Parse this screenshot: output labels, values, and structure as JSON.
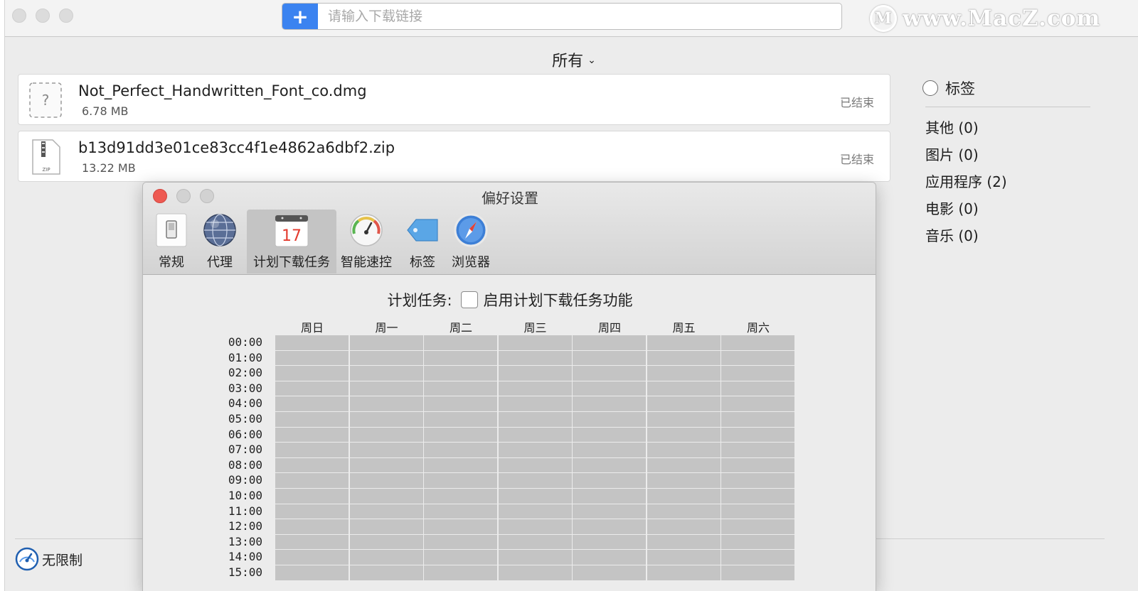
{
  "toolbar": {
    "add_icon": "plus-icon",
    "url_placeholder": "请输入下载链接",
    "accent": "#3b83f0"
  },
  "watermark": {
    "text": "www.MacZ.com",
    "logo_glyph": "M"
  },
  "filter": {
    "label": "所有"
  },
  "downloads": [
    {
      "name": "Not_Perfect_Handwritten_Font_co.dmg",
      "size": "6.78 MB",
      "status": "已结束",
      "icon": "unknown-file-icon",
      "glyph": "?"
    },
    {
      "name": "b13d91dd3e01ce83cc4f1e4862a6dbf2.zip",
      "size": "13.22 MB",
      "status": "已结束",
      "icon": "zip-file-icon",
      "glyph": "ZIP"
    }
  ],
  "sidebar": {
    "header": "标签",
    "items": [
      "其他 (0)",
      "图片 (0)",
      "应用程序 (2)",
      "电影 (0)",
      "音乐 (0)"
    ]
  },
  "footer": {
    "speed_label": "无限制"
  },
  "prefs": {
    "title": "偏好设置",
    "tabs": [
      {
        "label": "常规",
        "icon": "switch-icon"
      },
      {
        "label": "代理",
        "icon": "globe-icon"
      },
      {
        "label": "计划下载任务",
        "icon": "calendar-icon",
        "active": true,
        "calendar_day": "17"
      },
      {
        "label": "智能速控",
        "icon": "speedometer-icon"
      },
      {
        "label": "标签",
        "icon": "tag-icon"
      },
      {
        "label": "浏览器",
        "icon": "compass-icon"
      }
    ],
    "schedule": {
      "label": "计划任务:",
      "checkbox_label": "启用计划下载任务功能",
      "enabled": false,
      "days": [
        "周日",
        "周一",
        "周二",
        "周三",
        "周四",
        "周五",
        "周六"
      ],
      "hours": [
        "00:00",
        "01:00",
        "02:00",
        "03:00",
        "04:00",
        "05:00",
        "06:00",
        "07:00",
        "08:00",
        "09:00",
        "10:00",
        "11:00",
        "12:00",
        "13:00",
        "14:00",
        "15:00"
      ]
    }
  }
}
